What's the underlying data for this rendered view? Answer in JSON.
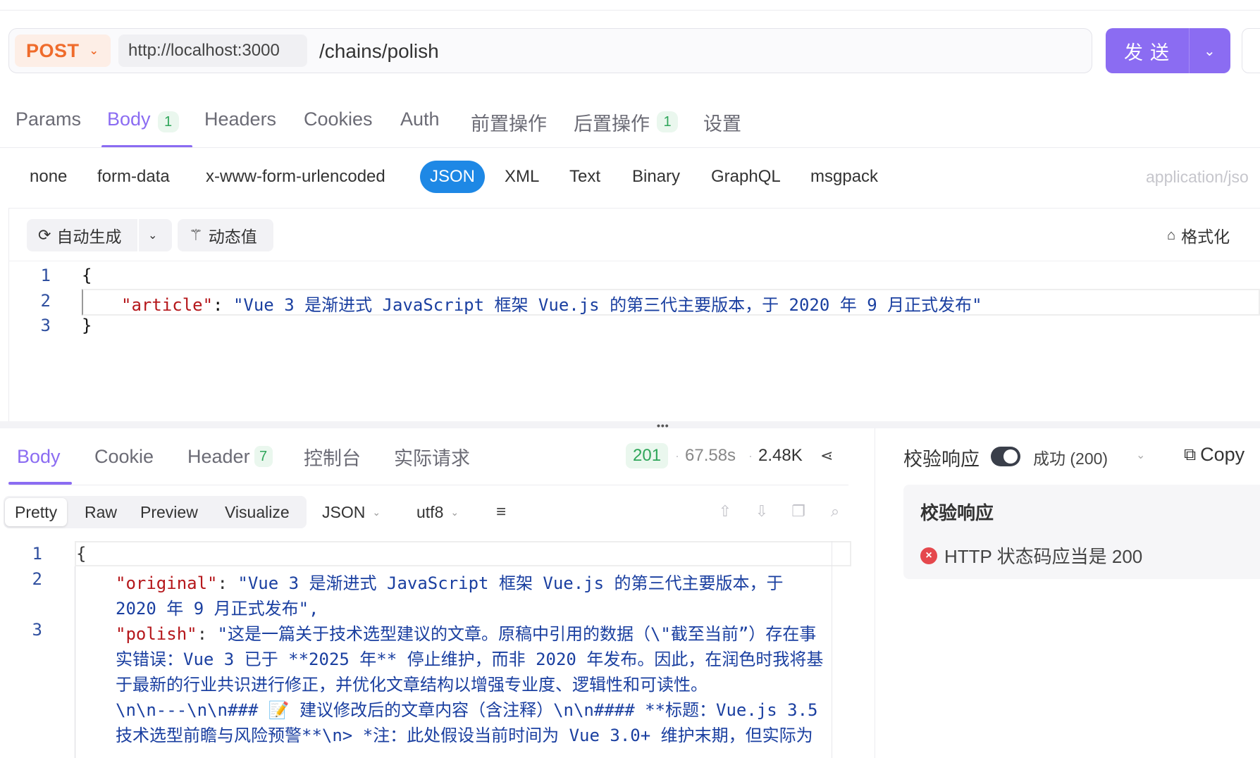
{
  "request": {
    "method": "POST",
    "base_url": "http://localhost:3000",
    "path": "/chains/polish",
    "send_label": "发送"
  },
  "request_tabs": [
    {
      "label": "Params",
      "badge": ""
    },
    {
      "label": "Body",
      "badge": "1",
      "active": true
    },
    {
      "label": "Headers",
      "badge": ""
    },
    {
      "label": "Cookies",
      "badge": ""
    },
    {
      "label": "Auth",
      "badge": ""
    },
    {
      "label": "前置操作",
      "badge": ""
    },
    {
      "label": "后置操作",
      "badge": "1"
    },
    {
      "label": "设置",
      "badge": ""
    }
  ],
  "body_types": [
    "none",
    "form-data",
    "x-www-form-urlencoded",
    "JSON",
    "XML",
    "Text",
    "Binary",
    "GraphQL",
    "msgpack"
  ],
  "body_type_selected": "JSON",
  "content_type": "application/jso",
  "editor_toolbar": {
    "auto_generate": "自动生成",
    "dynamic_value": "动态值",
    "format": "格式化"
  },
  "request_body": {
    "line_numbers": [
      "1",
      "2",
      "3"
    ],
    "open_brace": "{",
    "key": "\"article\"",
    "colon": ": ",
    "value": "\"Vue 3 是渐进式 JavaScript 框架 Vue.js 的第三代主要版本，于 2020 年 9 月正式发布\"",
    "close_brace": "}"
  },
  "response_tabs": [
    {
      "label": "Body",
      "badge": "",
      "active": true
    },
    {
      "label": "Cookie",
      "badge": ""
    },
    {
      "label": "Header",
      "badge": "7"
    },
    {
      "label": "控制台",
      "badge": ""
    },
    {
      "label": "实际请求",
      "badge": ""
    }
  ],
  "response_meta": {
    "status": "201",
    "time": "67.58s",
    "size": "2.48K"
  },
  "response_view_modes": [
    "Pretty",
    "Raw",
    "Preview",
    "Visualize"
  ],
  "response_view_selected": "Pretty",
  "response_format": "JSON",
  "response_encoding": "utf8",
  "response_body": {
    "line_numbers": [
      "1",
      "2",
      "3"
    ],
    "open_brace": "{",
    "original_key": "\"original\"",
    "original_value_1": "\"Vue 3 是渐进式 JavaScript 框架 Vue.js 的第三代主要版本，于",
    "original_value_2": "2020 年 9 月正式发布\",",
    "polish_key": "\"polish\"",
    "polish_lines": [
      "\"这是一篇关于技术选型建议的文章。原稿中引用的数据（\\\"截至当前”）存在事",
      "实错误：Vue 3 已于 **2025 年** 停止维护，而非 2020 年发布。因此，在润色时我将基",
      "于最新的行业共识进行修正，并优化文章结构以增强专业度、逻辑性和可读性。",
      "\\n\\n---\\n\\n### 📝 建议修改后的文章内容（含注释）\\n\\n#### **标题：Vue.js 3.5",
      "技术选型前瞻与风险预警**\\n> *注：此处假设当前时间为 Vue 3.0+ 维护末期，但实际为"
    ]
  },
  "validation": {
    "header_label": "校验响应",
    "result_select": "成功 (200)",
    "copy_label": "Copy",
    "box_title": "校验响应",
    "item": "HTTP 状态码应当是 200"
  },
  "colors": {
    "accent": "#8b6cf2",
    "method": "#ef6b2b",
    "json_active": "#1e88e5",
    "success": "#2fa65a",
    "error": "#e5484d"
  }
}
